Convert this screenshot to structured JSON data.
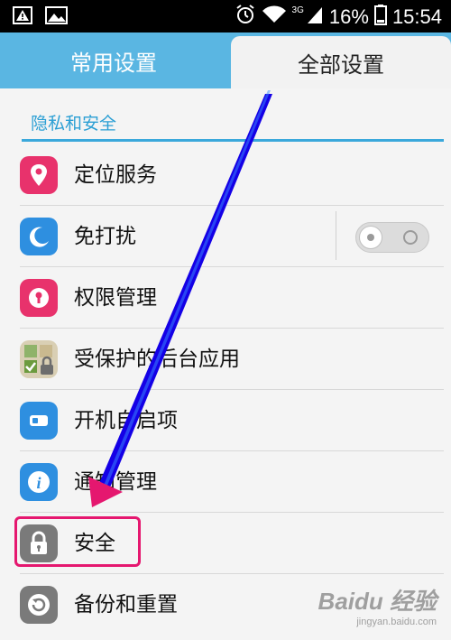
{
  "status_bar": {
    "network": "3G",
    "battery": "16%",
    "time": "15:54",
    "icons": [
      "warning-icon",
      "image-icon",
      "alarm-icon",
      "wifi-icon",
      "signal-icon",
      "battery-icon"
    ]
  },
  "tabs": [
    {
      "label": "常用设置",
      "selected": false
    },
    {
      "label": "全部设置",
      "selected": true
    }
  ],
  "section": {
    "title": "隐私和安全"
  },
  "items": [
    {
      "label": "定位服务",
      "icon": "location-pin-icon",
      "color": "#e8326c"
    },
    {
      "label": "免打扰",
      "icon": "moon-icon",
      "color": "#2e8fe0",
      "toggle": "off"
    },
    {
      "label": "权限管理",
      "icon": "keyhole-icon",
      "color": "#e8326c"
    },
    {
      "label": "受保护的后台应用",
      "icon": "protected-apps-icon",
      "color": "#b7a37a"
    },
    {
      "label": "开机自启项",
      "icon": "power-switch-icon",
      "color": "#2e8fe0"
    },
    {
      "label": "通知管理",
      "icon": "info-icon",
      "color": "#2e8fe0"
    },
    {
      "label": "安全",
      "icon": "padlock-icon",
      "color": "#7a7a7a"
    },
    {
      "label": "备份和重置",
      "icon": "restore-icon",
      "color": "#7a7a7a"
    }
  ],
  "annotation": {
    "arrow_color": "#1400e6",
    "highlight_color": "#e5176f"
  },
  "watermark": {
    "main": "Baidu 经验",
    "sub": "jingyan.baidu.com"
  }
}
